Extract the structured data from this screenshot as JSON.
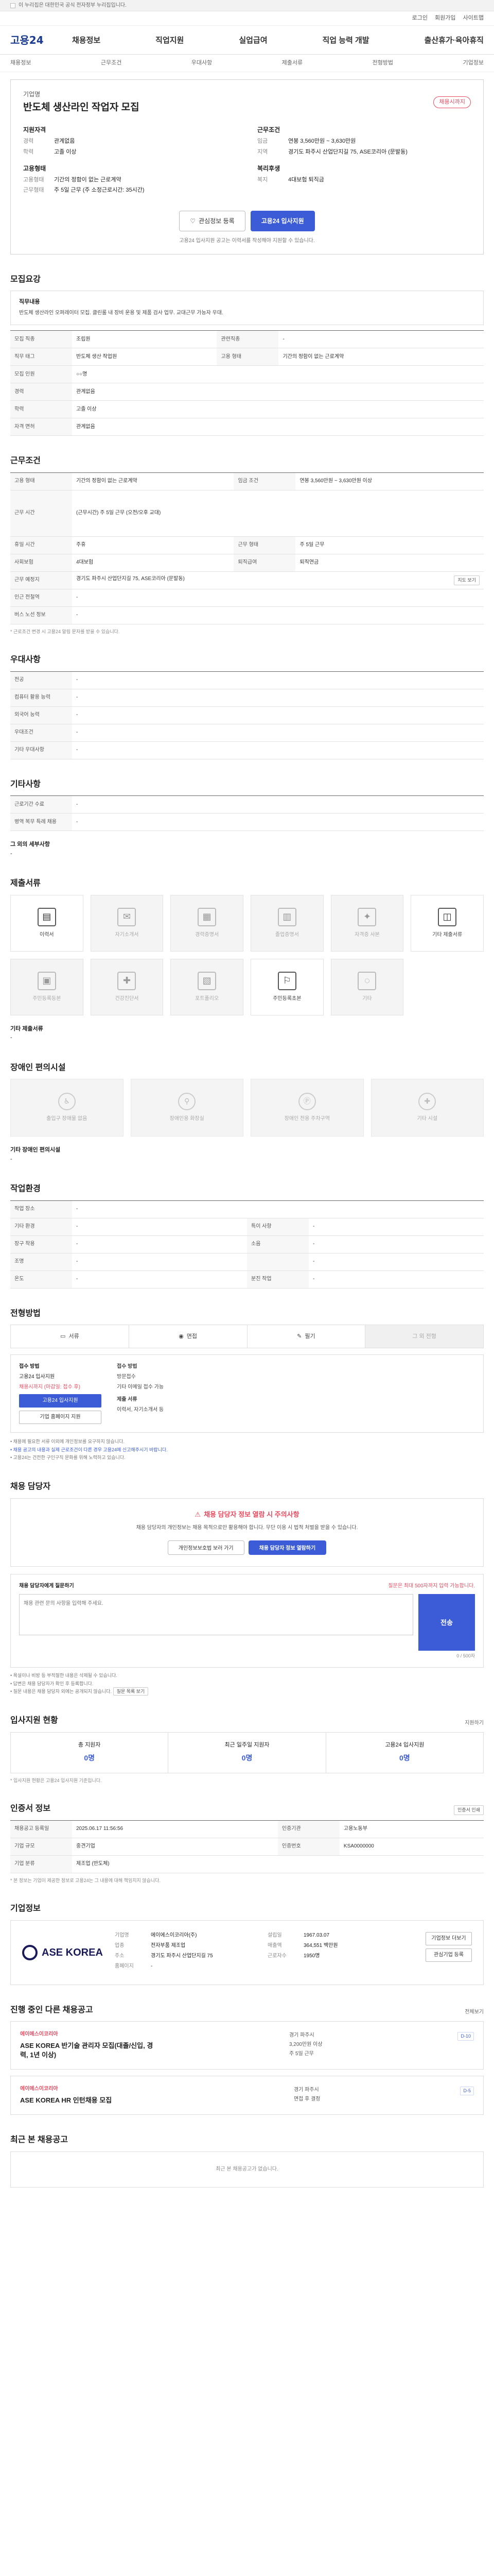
{
  "topbar": {
    "notice": "이 누리집은 대한민국 공식 전자정부 누리집입니다."
  },
  "util": {
    "login": "로그인",
    "join": "회원가입",
    "sitemap": "사이트맵"
  },
  "gnb": {
    "logo": "고용24",
    "menu": [
      "채용정보",
      "직업지원",
      "실업급여",
      "직업 능력 개발",
      "출산휴가·육아휴직"
    ]
  },
  "snb": {
    "items": [
      "채용정보",
      "근무조건",
      "우대사항",
      "제출서류",
      "전형방법",
      "기업정보"
    ]
  },
  "hero": {
    "org": "기업명",
    "title": "반도체 생산라인 작업자 모집",
    "badge": "채용시까지",
    "left": {
      "title": "지원자격",
      "rows": [
        {
          "k": "경력",
          "v": "관계없음"
        },
        {
          "k": "학력",
          "v": "고졸 이상"
        }
      ],
      "title2": "고용형태",
      "rows2": [
        {
          "k": "고용형태",
          "v": "기간의 정함이 없는 근로계약"
        },
        {
          "k": "근무형태",
          "v": "주 5일 근무 (주 소정근로시간: 35시간)"
        }
      ]
    },
    "right": {
      "title": "근무조건",
      "rows": [
        {
          "k": "임금",
          "v": "연봉 3,560만원 ~ 3,630만원"
        },
        {
          "k": "지역",
          "v": "경기도 파주시 산업단지길 75, ASE코리아 (문발동)"
        }
      ],
      "title2": "복리후생",
      "rows2": [
        {
          "k": "복지",
          "v": "4대보험 퇴직금"
        }
      ]
    },
    "btn_scrap": "관심정보 등록",
    "btn_apply": "고용24 입사지원",
    "notice": "고용24 입사지원 공고는 이력서를 작성해야 지원할 수 있습니다."
  },
  "recruit": {
    "h": "모집요강",
    "box_label": "직무내용",
    "box_text": "반도체 생산라인 오퍼레이터 모집. 클린룸 내 장비 운용 및 제품 검사 업무. 교대근무 가능자 우대.",
    "rows": [
      [
        "모집 직종",
        "조립원",
        "관련직종",
        "-"
      ],
      [
        "직무 태그",
        "반도체 생산 작업원",
        "고용 형태",
        "기간의 정함이 없는 근로계약"
      ],
      [
        "모집 인원",
        "○○명",
        "",
        ""
      ],
      [
        "경력",
        "관계없음",
        "",
        ""
      ],
      [
        "학력",
        "고졸 이상",
        "",
        ""
      ],
      [
        "자격 면허",
        "관계없음",
        "",
        ""
      ]
    ]
  },
  "work": {
    "h": "근무조건",
    "rows": [
      [
        "고용 형태",
        "기간의 정함이 없는 근로계약",
        "임금 조건",
        "연봉 3,560만원 ~ 3,630만원 이상"
      ],
      [
        "",
        "",
        ""
      ],
      [
        "근무 시간",
        "(근무시간) 주 5일 근무 (오전/오후 교대)",
        "",
        ""
      ],
      [
        "",
        "",
        ""
      ],
      [
        "휴일 시간",
        "주휴",
        "근무 형태",
        "주 5일 근무"
      ],
      [
        "사회보험",
        "4대보험",
        "퇴직급여",
        "퇴직연금"
      ],
      [
        "근무 예정지",
        "경기도 파주시 산업단지길 75, ASE코리아 (문발동)",
        "",
        ""
      ],
      [
        "인근 전철역",
        "-",
        "",
        ""
      ],
      [
        "버스 노선 정보",
        "-",
        "",
        ""
      ]
    ],
    "footnote": "* 근로조건 변경 시 고용24 알림 문자를 받을 수 있습니다."
  },
  "pref": {
    "h": "우대사항",
    "rows": [
      [
        "전공",
        "-"
      ],
      [
        "컴퓨터 활용 능력",
        "-"
      ],
      [
        "외국어 능력",
        "-"
      ],
      [
        "우대조건",
        "-"
      ],
      [
        "기타 우대사항",
        "-"
      ]
    ]
  },
  "etc": {
    "h": "기타사항",
    "rows": [
      [
        "근로기간 수료",
        "-"
      ],
      [
        "병역 복무 특례 채용",
        "-"
      ]
    ],
    "label": "그 외의 세부사항",
    "value": "-"
  },
  "docs": {
    "h": "제출서류",
    "items": [
      {
        "l": "이력서",
        "on": true
      },
      {
        "l": "자기소개서",
        "on": false
      },
      {
        "l": "경력증명서",
        "on": false
      },
      {
        "l": "졸업증명서",
        "on": false
      },
      {
        "l": "자격증 사본",
        "on": false
      },
      {
        "l": "기타 제출서류",
        "on": true
      },
      {
        "l": "주민등록등본",
        "on": false
      },
      {
        "l": "건강진단서",
        "on": false
      },
      {
        "l": "포트폴리오",
        "on": false
      },
      {
        "l": "주민등록초본",
        "on": true
      },
      {
        "l": "기타",
        "on": false
      }
    ],
    "label": "기타 제출서류",
    "value": "-"
  },
  "welfare": {
    "h": "장애인 편의시설",
    "items": [
      "출입구 장애물 없음",
      "장애인용 화장실",
      "장애인 전용 주차구역",
      "기타 시설"
    ],
    "label": "기타 장애인 편의시설",
    "value": "-"
  },
  "env": {
    "h": "작업환경",
    "rows": [
      [
        "작업 장소",
        "-",
        "",
        ""
      ],
      [
        "기타 환경",
        "-",
        "특이 사항",
        "-"
      ],
      [
        "장구 착용",
        "-",
        "소음",
        "-"
      ],
      [
        "조명",
        "-",
        "",
        "-"
      ],
      [
        "온도",
        "-",
        "분진 작업",
        "-"
      ]
    ]
  },
  "method": {
    "h": "전형방법",
    "tabs": [
      "서류",
      "면접",
      "필기",
      "그 외 전형"
    ],
    "lab1": "접수 방법",
    "apply_label": "고용24 입사지원",
    "period": "채용시까지 (마감일: 접수 후)",
    "btn1": "고용24 입사지원",
    "btn2": "기업 홈페이지 지원",
    "lab2": "접수 방법",
    "col2": [
      "방문접수",
      "기타 이메일 접수 가능"
    ],
    "lab3": "제출 서류",
    "col3": [
      "이력서, 자기소개서 등"
    ],
    "notes": [
      "• 채용에 필요한 서류 이외에 개인정보를 요구하지 않습니다.",
      "• 채용 공고의 내용과 실제 근로조건이 다른 경우 고용24에 신고해주시기 바랍니다.",
      "• 고용24는 건전한 구인구직 문화를 위해 노력하고 있습니다."
    ]
  },
  "contact": {
    "h": "채용 담당자",
    "warn_h": "채용 담당자 정보 열람 시 주의사항",
    "warn_d": "채용 담당자의 개인정보는 채용 목적으로만 활용해야 합니다. 무단 이용 시 법적 처벌을 받을 수 있습니다.",
    "btn1": "개인정보보호법 보러 가기",
    "btn2": "채용 담당자 정보 열람하기",
    "q_label": "채용 담당자에게 질문하기",
    "q_note": "질문은 최대 500자까지 입력 가능합니다.",
    "q_placeholder": "채용 관련 문의 사항을 입력해 주세요.",
    "q_send": "전송",
    "q_count": "0 / 500자",
    "qnotes": [
      "• 욕설이나 비방 등 부적절한 내용은 삭제될 수 있습니다.",
      "• 답변은 채용 담당자가 확인 후 등록합니다.",
      "• 질문 내용은 채용 담당자 외에는 공개되지 않습니다."
    ],
    "qbtn": "질문 목록 보기"
  },
  "apply_status": {
    "h": "입사지원 현황",
    "more": "지원하기",
    "stats": [
      {
        "l": "총 지원자",
        "v": "0명"
      },
      {
        "l": "최근 일주일 지원자",
        "v": "0명"
      },
      {
        "l": "고용24 입사지원",
        "v": "0명"
      }
    ],
    "note": "* 입사지원 현황은 고용24 입사지원 기준입니다."
  },
  "info": {
    "h": "인증서 정보",
    "more": "인증서 인쇄",
    "rows": [
      [
        "채용공고 등록일",
        "2025.06.17 11:56:56",
        "인증기관",
        "고용노동부"
      ],
      [
        "기업 규모",
        "중견기업",
        "인증번호",
        "KSA0000000"
      ],
      [
        "기업 분류",
        "제조업 (반도체)",
        "",
        ""
      ]
    ],
    "note": "* 본 정보는 기업이 제공한 정보로 고용24는 그 내용에 대해 책임지지 않습니다."
  },
  "company": {
    "h": "기업정보",
    "logo": "ASE KOREA",
    "rows": [
      [
        "기업명",
        "에이에스이코리아(주)",
        "설립일",
        "1967.03.07"
      ],
      [
        "업종",
        "전자부품 제조업",
        "매출액",
        "364,551 백만원"
      ],
      [
        "주소",
        "경기도 파주시 산업단지길 75",
        "근로자수",
        "1950명"
      ],
      [
        "홈페이지",
        "-",
        "",
        ""
      ]
    ],
    "btn1": "기업정보 더보기",
    "btn2": "관심기업 등록"
  },
  "jobs": {
    "h": "진행 중인 다른 채용공고",
    "more": "전체보기",
    "list": [
      {
        "co": "에이에스이코리아",
        "title": "ASE KOREA 반기술 관리자 모집(대졸/신입, 경력, 1년 이상)",
        "meta": [
          "경기 파주시",
          "3,200만원 이상",
          "주 5일 근무"
        ],
        "tag": "D-10"
      },
      {
        "co": "에이에스이코리아",
        "title": "ASE KOREA HR 인턴채용 모집",
        "meta": [
          "경기 파주시",
          "면접 후 결정"
        ],
        "tag": "D-5"
      }
    ]
  },
  "recent": {
    "h": "최근 본 채용공고",
    "empty": "최근 본 채용공고가 없습니다."
  }
}
